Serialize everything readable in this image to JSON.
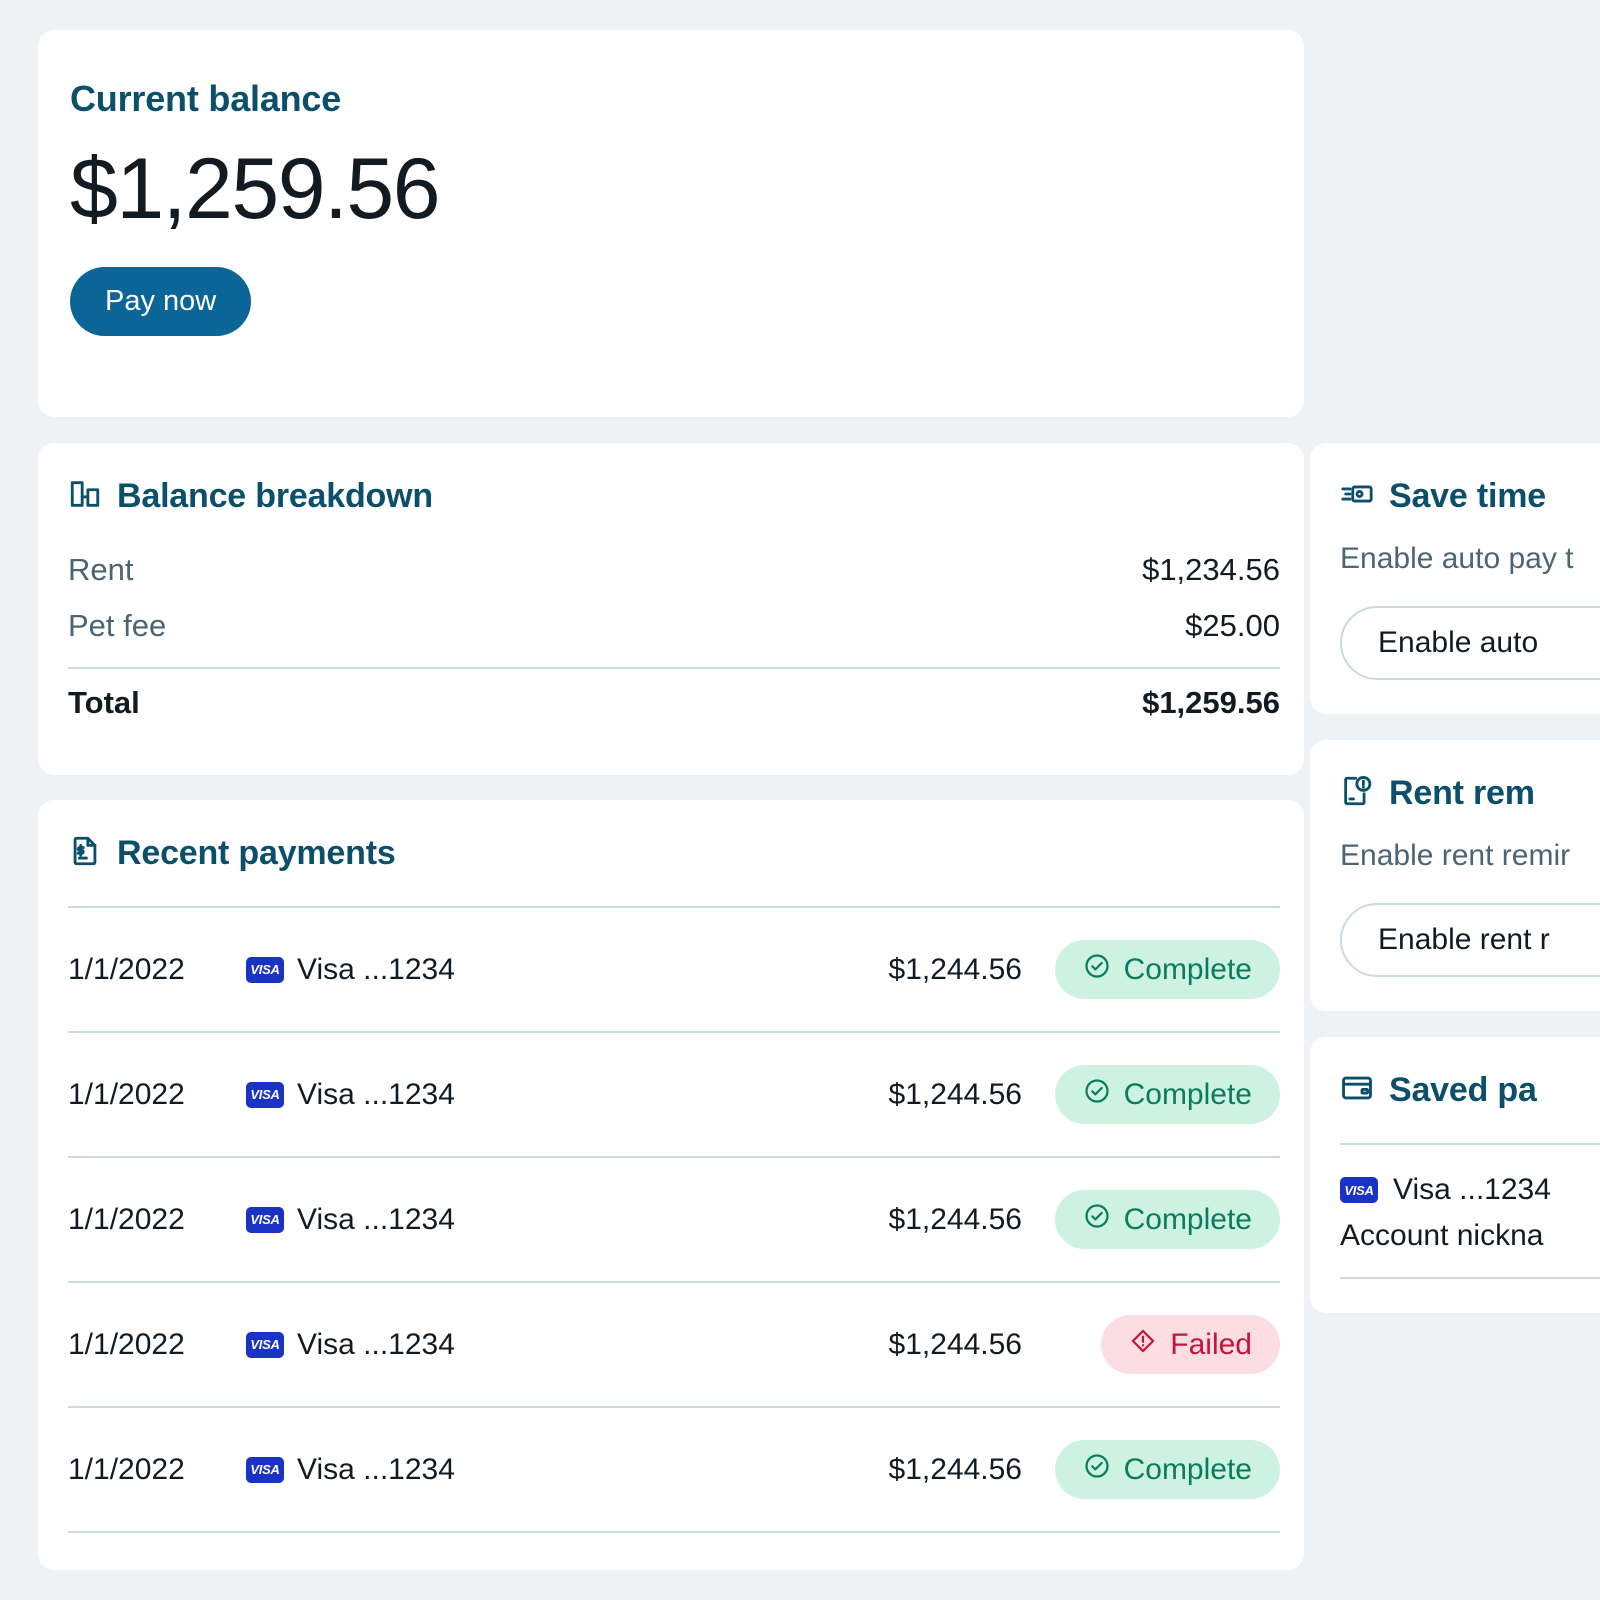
{
  "balance": {
    "title": "Current balance",
    "amount": "$1,259.56",
    "pay_button": "Pay now"
  },
  "breakdown": {
    "title": "Balance breakdown",
    "icon": "bar-chart-icon",
    "rows": [
      {
        "label": "Rent",
        "value": "$1,234.56"
      },
      {
        "label": "Pet fee",
        "value": "$25.00"
      }
    ],
    "total": {
      "label": "Total",
      "value": "$1,259.56"
    }
  },
  "recent_payments": {
    "title": "Recent payments",
    "icon": "document-dollar-icon",
    "rows": [
      {
        "date": "1/1/2022",
        "method": "Visa ...1234",
        "brand": "VISA",
        "amount": "$1,244.56",
        "status": "Complete",
        "status_type": "complete"
      },
      {
        "date": "1/1/2022",
        "method": "Visa ...1234",
        "brand": "VISA",
        "amount": "$1,244.56",
        "status": "Complete",
        "status_type": "complete"
      },
      {
        "date": "1/1/2022",
        "method": "Visa ...1234",
        "brand": "VISA",
        "amount": "$1,244.56",
        "status": "Complete",
        "status_type": "complete"
      },
      {
        "date": "1/1/2022",
        "method": "Visa ...1234",
        "brand": "VISA",
        "amount": "$1,244.56",
        "status": "Failed",
        "status_type": "failed"
      },
      {
        "date": "1/1/2022",
        "method": "Visa ...1234",
        "brand": "VISA",
        "amount": "$1,244.56",
        "status": "Complete",
        "status_type": "complete"
      }
    ]
  },
  "save_time": {
    "title": "Save time",
    "icon": "auto-pay-icon",
    "subtitle": "Enable auto pay t",
    "button": "Enable auto"
  },
  "rent_reminders": {
    "title": "Rent rem",
    "icon": "document-alert-icon",
    "subtitle": "Enable rent remir",
    "button": "Enable rent r"
  },
  "saved_payment": {
    "title": "Saved pa",
    "icon": "credit-card-icon",
    "method": "Visa ...1234",
    "brand": "VISA",
    "nickname": "Account nickna"
  },
  "colors": {
    "page_bg": "#eff2f5",
    "card_bg": "#ffffff",
    "heading": "#0c4f6a",
    "primary": "#0b6597",
    "muted_text": "#4d6573",
    "body_text": "#121b22",
    "divider": "#ccd9e0",
    "badge_complete_bg": "#cdf2e2",
    "badge_complete_fg": "#0a7b5c",
    "badge_failed_bg": "#fcdde2",
    "badge_failed_fg": "#c6123b",
    "visa_blue": "#1a33c4"
  }
}
